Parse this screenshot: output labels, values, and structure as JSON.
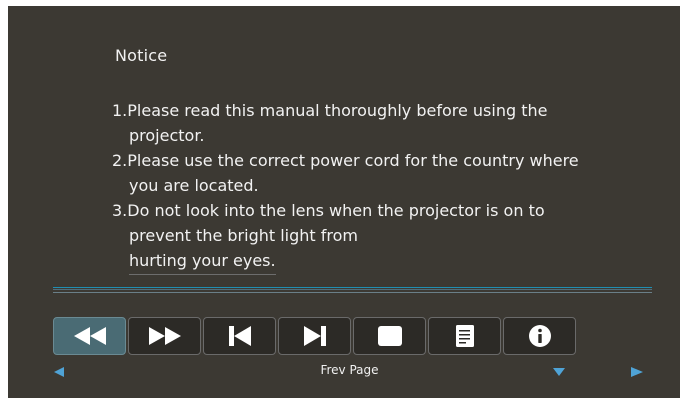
{
  "notice": {
    "title": "Notice",
    "lines": [
      "1.Please read this manual thoroughly before using the",
      "projector.",
      "2.Please use the correct power cord for the country where",
      "you are located.",
      "3.Do not look into the lens when the projector is on to",
      "prevent the bright light from",
      "hurting your eyes."
    ]
  },
  "toolbar": {
    "buttons": [
      {
        "icon": "rewind-icon",
        "active": true
      },
      {
        "icon": "fast-forward-icon",
        "active": false
      },
      {
        "icon": "skip-previous-icon",
        "active": false
      },
      {
        "icon": "skip-next-icon",
        "active": false
      },
      {
        "icon": "stop-icon",
        "active": false
      },
      {
        "icon": "document-icon",
        "active": false
      },
      {
        "icon": "info-icon",
        "active": false
      }
    ]
  },
  "status": {
    "label": "Frev Page"
  },
  "colors": {
    "screen_bg": "#3c3933",
    "accent": "#4a6b74",
    "arrow": "#4fa3d6",
    "divider": "#1f8fb3"
  }
}
